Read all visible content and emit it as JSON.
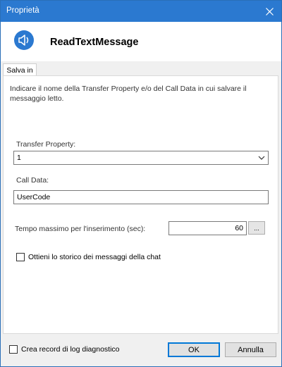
{
  "window": {
    "title": "Proprietà"
  },
  "header": {
    "title": "ReadTextMessage",
    "icon": "speaker-icon",
    "accent": "#2b79d0"
  },
  "tabs": [
    {
      "label": "Salva in"
    }
  ],
  "panel": {
    "description": "Indicare il nome della Transfer Property e/o del Call Data in cui salvare il messaggio letto.",
    "transfer_property": {
      "label": "Transfer Property:",
      "value": "1"
    },
    "call_data": {
      "label": "Call Data:",
      "value": "UserCode"
    },
    "timeout": {
      "label": "Tempo massimo per l'inserimento (sec):",
      "value": "60",
      "browse_label": "..."
    },
    "history_checkbox": {
      "label": "Ottieni lo storico dei messaggi della chat",
      "checked": false
    }
  },
  "footer": {
    "diagnostic_checkbox": {
      "label": "Crea record di log diagnostico",
      "checked": false
    },
    "ok_label": "OK",
    "cancel_label": "Annulla"
  }
}
